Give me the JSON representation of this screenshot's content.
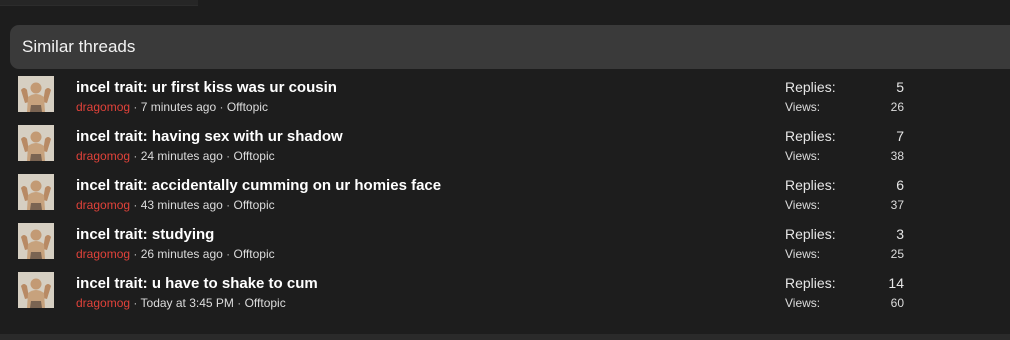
{
  "section": {
    "title": "Similar threads"
  },
  "threads": [
    {
      "title": "incel trait: ur first kiss was ur cousin",
      "author": "dragomog",
      "time": "7 minutes ago",
      "forum": "Offtopic",
      "replies_label": "Replies:",
      "replies": "5",
      "views_label": "Views:",
      "views": "26"
    },
    {
      "title": "incel trait: having sex with ur shadow",
      "author": "dragomog",
      "time": "24 minutes ago",
      "forum": "Offtopic",
      "replies_label": "Replies:",
      "replies": "7",
      "views_label": "Views:",
      "views": "38"
    },
    {
      "title": "incel trait: accidentally cumming on ur homies face",
      "author": "dragomog",
      "time": "43 minutes ago",
      "forum": "Offtopic",
      "replies_label": "Replies:",
      "replies": "6",
      "views_label": "Views:",
      "views": "37"
    },
    {
      "title": "incel trait: studying",
      "author": "dragomog",
      "time": "26 minutes ago",
      "forum": "Offtopic",
      "replies_label": "Replies:",
      "replies": "3",
      "views_label": "Views:",
      "views": "25"
    },
    {
      "title": "incel trait: u have to shake to cum",
      "author": "dragomog",
      "time": "Today at 3:45 PM",
      "forum": "Offtopic",
      "replies_label": "Replies:",
      "replies": "14",
      "views_label": "Views:",
      "views": "60"
    }
  ],
  "separator": "·",
  "colors": {
    "author": "#e0423a",
    "background": "#1d1d1d",
    "header": "#3a3a3a"
  },
  "icons": {
    "avatar": "user-avatar-photo"
  }
}
